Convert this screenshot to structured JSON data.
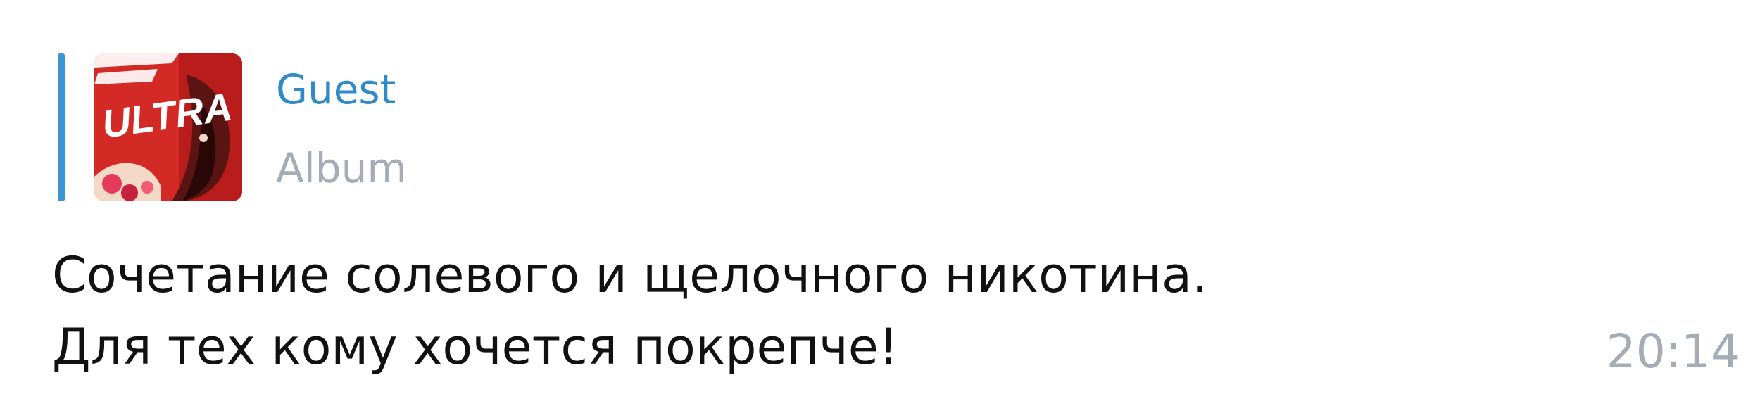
{
  "reply": {
    "author": "Guest",
    "subtitle": "Album",
    "thumbnail_icon": "album-cover-thumbnail",
    "thumbnail_text": "ULTRA",
    "accent_color": "#3d95d3"
  },
  "message": {
    "lines": [
      "Сочетание солевого и щелочного никотина.",
      "Для тех кому хочется покрепче!"
    ],
    "time": "20:14"
  },
  "colors": {
    "reply_title": "#2f8ac8",
    "meta_gray": "#a4acb5",
    "text": "#111111"
  }
}
